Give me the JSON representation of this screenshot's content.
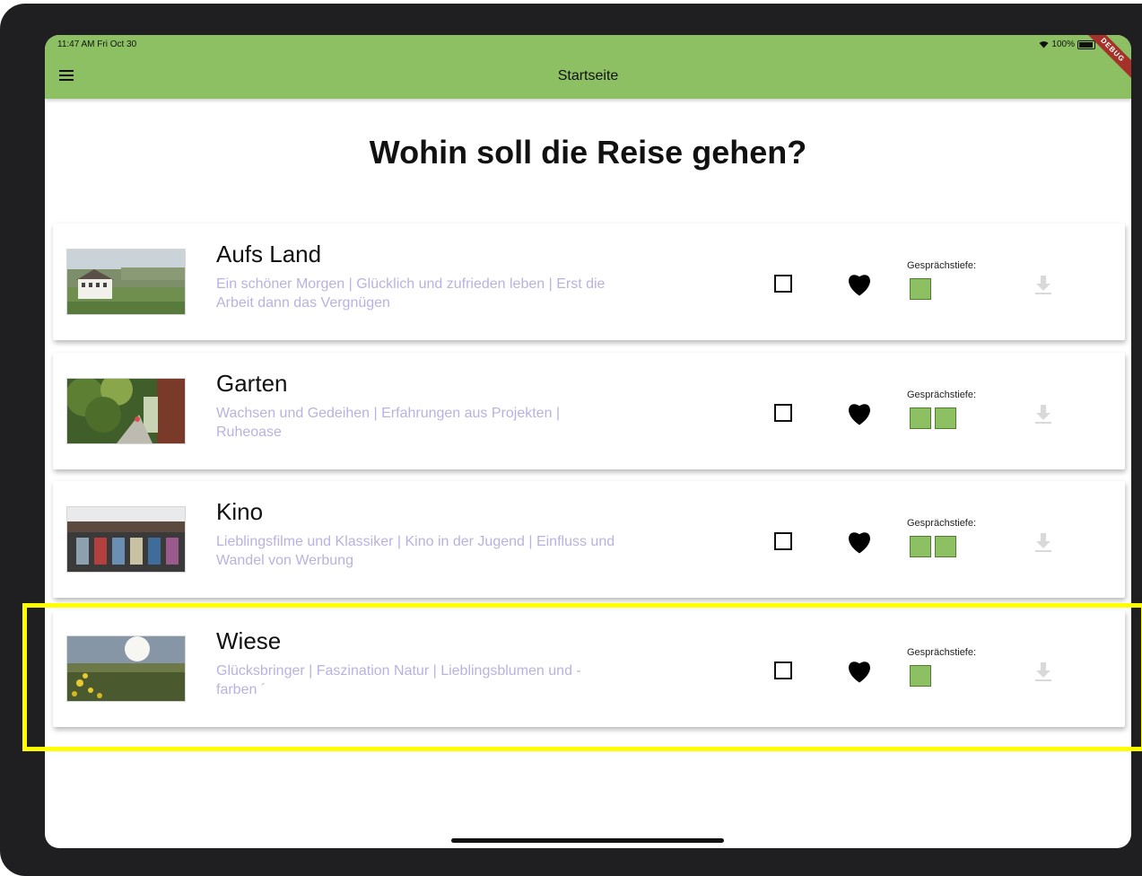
{
  "status_bar": {
    "time": "11:47 AM  Fri Oct 30",
    "battery": "100%"
  },
  "appbar": {
    "title": "Startseite",
    "debug_label": "DEBUG"
  },
  "heading": "Wohin soll die Reise gehen?",
  "depth_label": "Gesprächstiefe:",
  "topics": [
    {
      "title": "Aufs Land",
      "subtitle": "Ein schöner Morgen | Glücklich und zufrieden leben | Erst die Arbeit dann das Vergnügen",
      "depth": 1
    },
    {
      "title": "Garten",
      "subtitle": "Wachsen und Gedeihen | Erfahrungen aus Projekten | Ruheoase",
      "depth": 2
    },
    {
      "title": "Kino",
      "subtitle": "Lieblingsfilme und Klassiker | Kino in der Jugend | Einfluss und Wandel von Werbung",
      "depth": 2
    },
    {
      "title": "Wiese",
      "subtitle": "Glücksbringer | Faszination Natur | Lieblingsblumen und -farben ´",
      "depth": 1
    }
  ],
  "colors": {
    "accent": "#8dc063",
    "subtitle": "#b9b2e0",
    "highlight": "#ffff00",
    "debug_ribbon": "#a4322b"
  }
}
